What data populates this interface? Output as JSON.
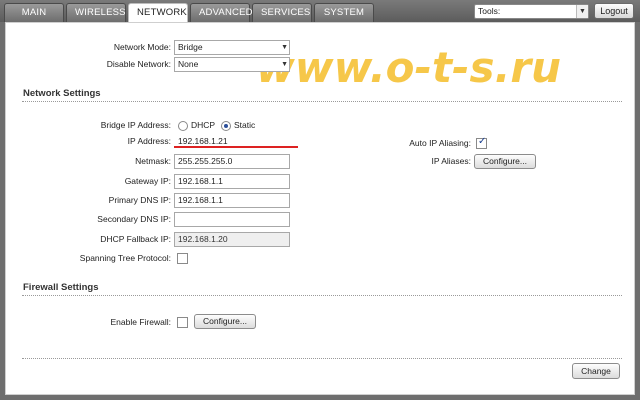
{
  "tabs": [
    {
      "label": "MAIN"
    },
    {
      "label": "WIRELESS"
    },
    {
      "label": "NETWORK"
    },
    {
      "label": "ADVANCED"
    },
    {
      "label": "SERVICES"
    },
    {
      "label": "SYSTEM"
    }
  ],
  "header": {
    "tools_label": "Tools:",
    "logout_label": "Logout"
  },
  "watermark": "www.o-t-s.ru",
  "network_mode": {
    "label": "Network Mode:",
    "value": "Bridge"
  },
  "disable_network": {
    "label": "Disable Network:",
    "value": "None"
  },
  "network_settings": {
    "title": "Network Settings",
    "bridge_ip": {
      "label": "Bridge IP Address:",
      "dhcp": "DHCP",
      "static": "Static",
      "selected": "static"
    },
    "ip_address": {
      "label": "IP Address:",
      "value": "192.168.1.21"
    },
    "netmask": {
      "label": "Netmask:",
      "value": "255.255.255.0"
    },
    "gateway_ip": {
      "label": "Gateway IP:",
      "value": "192.168.1.1"
    },
    "primary_dns": {
      "label": "Primary DNS IP:",
      "value": "192.168.1.1"
    },
    "secondary_dns": {
      "label": "Secondary DNS IP:",
      "value": ""
    },
    "dhcp_fallback": {
      "label": "DHCP Fallback IP:",
      "value": "192.168.1.20"
    },
    "spanning_tree": {
      "label": "Spanning Tree Protocol:",
      "checked": false
    },
    "auto_ip_aliasing": {
      "label": "Auto IP Aliasing:",
      "checked": true
    },
    "ip_aliases": {
      "label": "IP Aliases:",
      "button": "Configure..."
    }
  },
  "firewall_settings": {
    "title": "Firewall Settings",
    "enable_firewall": {
      "label": "Enable Firewall:",
      "checked": false,
      "button": "Configure..."
    }
  },
  "change_button": "Change"
}
